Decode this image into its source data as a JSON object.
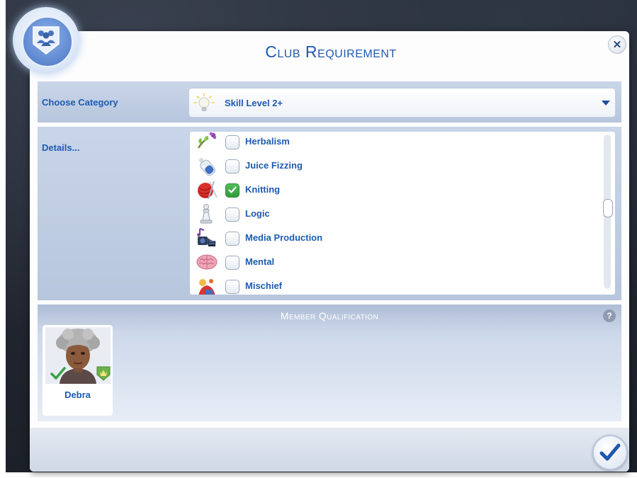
{
  "dialog": {
    "title": "Club Requirement"
  },
  "category": {
    "label": "Choose Category",
    "selected_value": "Skill Level 2+",
    "icon": "lightbulb-icon"
  },
  "details": {
    "label": "Details...",
    "items": [
      {
        "label": "Herbalism",
        "checked": false,
        "icon": "herbalism-skill-icon"
      },
      {
        "label": "Juice Fizzing",
        "checked": false,
        "icon": "juice-fizzing-skill-icon"
      },
      {
        "label": "Knitting",
        "checked": true,
        "icon": "knitting-skill-icon"
      },
      {
        "label": "Logic",
        "checked": false,
        "icon": "logic-skill-icon"
      },
      {
        "label": "Media Production",
        "checked": false,
        "icon": "media-production-skill-icon"
      },
      {
        "label": "Mental",
        "checked": false,
        "icon": "mental-skill-icon"
      },
      {
        "label": "Mischief",
        "checked": false,
        "icon": "mischief-skill-icon"
      }
    ]
  },
  "member_qualification": {
    "title": "Member Qualification",
    "help_label": "?",
    "members": [
      {
        "name": "Debra",
        "qualified": true
      }
    ]
  },
  "colors": {
    "accent": "#1e5ab1",
    "check_green": "#2f9a3b"
  }
}
